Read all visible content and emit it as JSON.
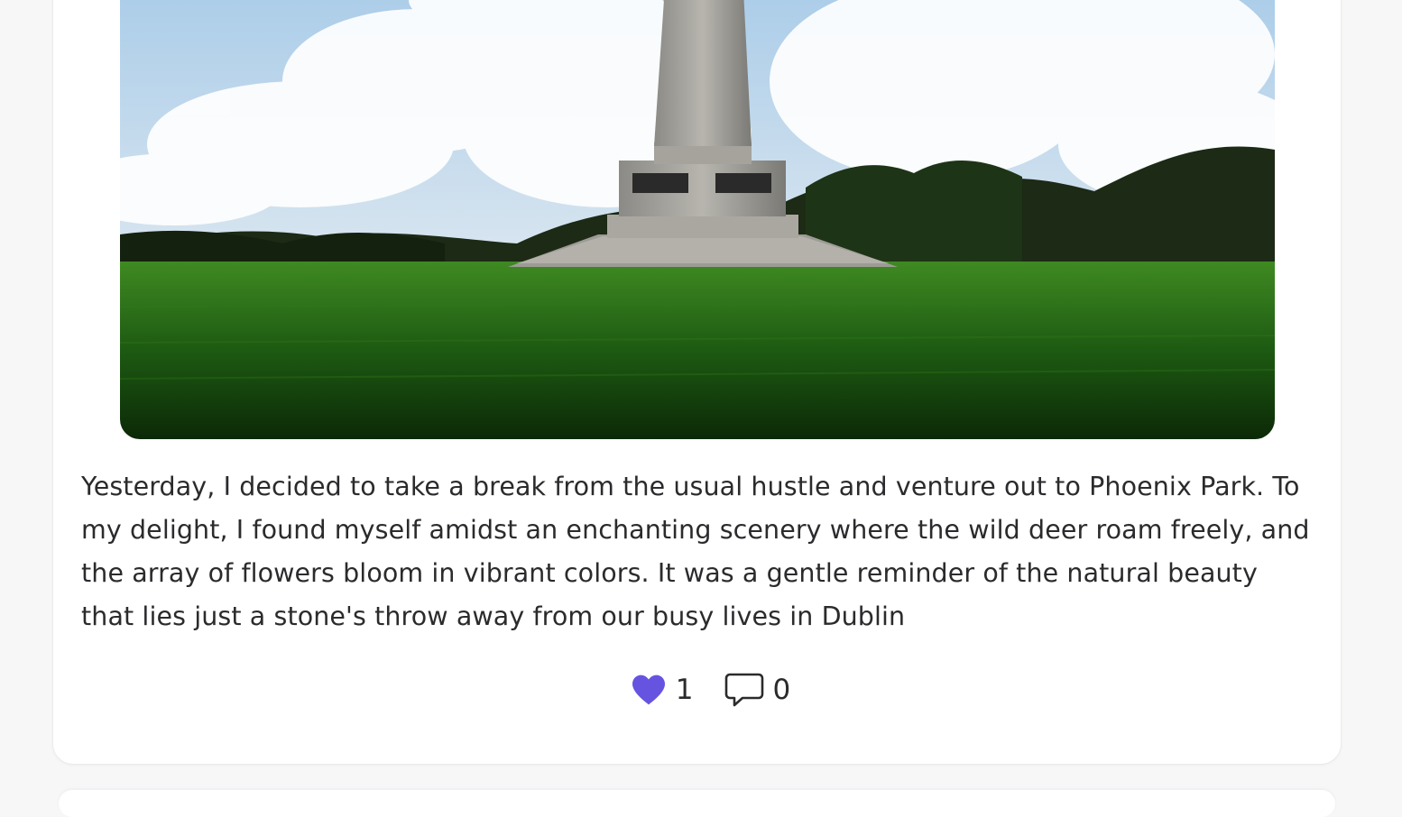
{
  "post": {
    "image_alt": "Wellington Monument in Phoenix Park",
    "text": "Yesterday, I decided to take a break from the usual hustle and venture out to Phoenix Park. To my delight, I found myself amidst an enchanting scenery where the wild deer roam freely, and the array of flowers bloom in vibrant colors. It was a gentle reminder of the natural beauty that lies just a stone's throw away from our busy lives in Dublin",
    "likes": "1",
    "comments": "0"
  },
  "icons": {
    "like": "heart-icon",
    "comment": "speech-bubble-icon"
  },
  "colors": {
    "accent": "#6654e0",
    "text": "#2b2b2e",
    "card": "#ffffff"
  }
}
